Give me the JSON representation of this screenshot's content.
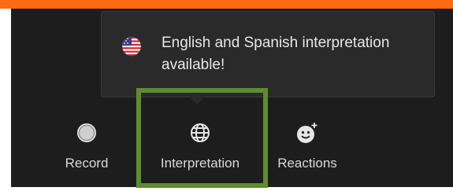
{
  "accent_color": "#ff6a13",
  "highlight_color": "#5e8c31",
  "tooltip": {
    "icon": "us-flag-icon",
    "message": "English and Spanish interpretation available!"
  },
  "toolbar": {
    "buttons": [
      {
        "label": "Record",
        "icon": "record-icon"
      },
      {
        "label": "Interpretation",
        "icon": "globe-icon"
      },
      {
        "label": "Reactions",
        "icon": "reactions-icon"
      }
    ]
  }
}
